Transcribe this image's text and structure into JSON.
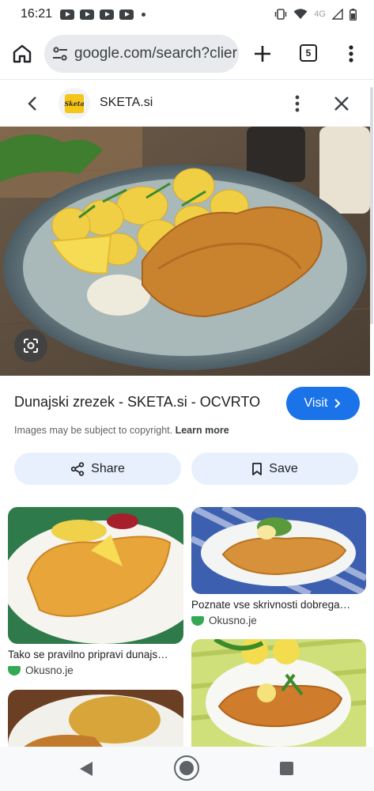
{
  "status_bar": {
    "time": "16:21",
    "network_label": "4G",
    "icons": [
      "youtube-icon",
      "youtube-icon",
      "youtube-icon",
      "youtube-icon",
      "vibrate-icon",
      "wifi-icon",
      "signal-icon",
      "battery-icon"
    ]
  },
  "browser": {
    "url": "google.com/search?clier",
    "tab_count": "5",
    "icons": [
      "home-icon",
      "site-settings-icon",
      "plus-icon",
      "more-vert-icon"
    ]
  },
  "lens_header": {
    "site_name": "SKETA.si",
    "logo_text": "Sketa",
    "icons": [
      "back-icon",
      "more-vert-icon",
      "close-icon"
    ]
  },
  "result": {
    "title": "Dunajski zrezek - SKETA.si - OCVRTO",
    "visit_label": "Visit",
    "copyright_text": "Images may be subject to copyright.",
    "learn_more_label": "Learn more",
    "share_label": "Share",
    "save_label": "Save"
  },
  "related": [
    {
      "caption": "Tako se pravilno pripravi dunajs…",
      "source": "Okusno.je"
    },
    {
      "caption": "Poznate vse skrivnosti dobrega…",
      "source": "Okusno.je"
    },
    {
      "caption": "",
      "source": ""
    },
    {
      "caption": "",
      "source": ""
    }
  ],
  "colors": {
    "accent": "#1a73e8",
    "pill_bg": "#e8f0fe",
    "source_icon": "#34a853"
  }
}
